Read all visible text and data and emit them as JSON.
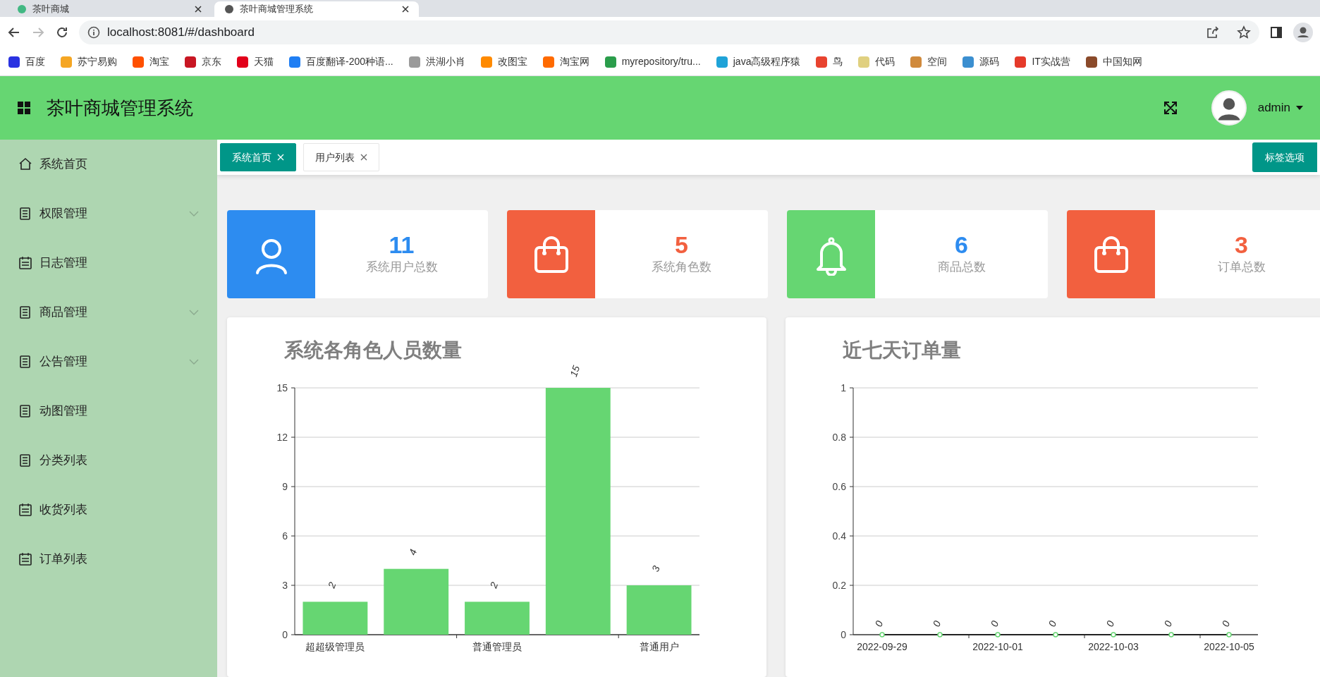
{
  "browser": {
    "tabs": [
      {
        "title": "茶叶商城",
        "selected": false
      },
      {
        "title": "茶叶商城管理系统",
        "selected": true
      }
    ],
    "url": "localhost:8081/#/dashboard",
    "bookmarks": [
      {
        "label": "百度",
        "color": "#2932e1"
      },
      {
        "label": "苏宁易购",
        "color": "#f5a623"
      },
      {
        "label": "淘宝",
        "color": "#ff5000"
      },
      {
        "label": "京东",
        "color": "#c81623"
      },
      {
        "label": "天猫",
        "color": "#e2001a"
      },
      {
        "label": "百度翻译-200种语...",
        "color": "#1f7ef3"
      },
      {
        "label": "洪湖小肖",
        "color": "#9a9a9a"
      },
      {
        "label": "改图宝",
        "color": "#ff8a00"
      },
      {
        "label": "淘宝网",
        "color": "#ff6a00"
      },
      {
        "label": "myrepository/tru...",
        "color": "#2a9d4b"
      },
      {
        "label": "java高级程序猿",
        "color": "#1fa3d8"
      },
      {
        "label": "鸟",
        "color": "#e8432f"
      },
      {
        "label": "代码",
        "color": "#e0d080"
      },
      {
        "label": "空间",
        "color": "#d08a3c"
      },
      {
        "label": "源码",
        "color": "#3b8fd0"
      },
      {
        "label": "IT实战营",
        "color": "#e53a2a"
      },
      {
        "label": "中国知网",
        "color": "#8a4a2a"
      }
    ]
  },
  "header": {
    "title": "茶叶商城管理系统",
    "user": "admin"
  },
  "sidebar": {
    "items": [
      {
        "label": "系统首页",
        "kind": "home"
      },
      {
        "label": "权限管理",
        "kind": "doc",
        "expanded": false
      },
      {
        "label": "日志管理",
        "kind": "calendar"
      },
      {
        "label": "商品管理",
        "kind": "doc",
        "expanded": false
      },
      {
        "label": "公告管理",
        "kind": "doc",
        "expanded": false
      },
      {
        "label": "动图管理",
        "kind": "doc"
      },
      {
        "label": "分类列表",
        "kind": "doc"
      },
      {
        "label": "收货列表",
        "kind": "calendar"
      },
      {
        "label": "订单列表",
        "kind": "calendar"
      }
    ]
  },
  "page_tabs": {
    "tabs": [
      {
        "label": "系统首页",
        "selected": true
      },
      {
        "label": "用户列表",
        "selected": false
      }
    ],
    "options_button": "标签选项"
  },
  "stats": [
    {
      "value": "11",
      "label": "系统用户总数",
      "kind": "user",
      "color": "#2d8cf0"
    },
    {
      "value": "5",
      "label": "系统角色数",
      "kind": "bag",
      "color": "#f2603f"
    },
    {
      "value": "6",
      "label": "商品总数",
      "kind": "bell",
      "color": "#2d8cf0"
    },
    {
      "value": "3",
      "label": "订单总数",
      "kind": "bag",
      "color": "#f2603f"
    }
  ],
  "charts": [
    {
      "chart_data": {
        "type": "bar",
        "title": "系统各角色人员数量",
        "categories": [
          "超超级管理员",
          null,
          "普通管理员",
          null,
          "普通用户"
        ],
        "series": [
          {
            "color": "#66d672",
            "values": [
              2,
              4,
              2,
              15,
              3
            ]
          }
        ],
        "ylim": [
          0,
          15
        ],
        "yticks": [
          0,
          3,
          6,
          9,
          12,
          15
        ],
        "grid": true,
        "data_labels": true
      }
    },
    {
      "chart_data": {
        "type": "line",
        "title": "近七天订单量",
        "categories": [
          "2022-09-29",
          null,
          "2022-10-01",
          null,
          "2022-10-03",
          null,
          "2022-10-05"
        ],
        "series": [
          {
            "color": "#66d672",
            "marker": true,
            "values": [
              0,
              0,
              0,
              0,
              0,
              0,
              0
            ]
          }
        ],
        "ylim": [
          0,
          1
        ],
        "yticks": [
          0,
          0.2,
          0.4,
          0.6,
          0.8,
          1
        ],
        "grid": true,
        "data_labels": true
      }
    }
  ]
}
